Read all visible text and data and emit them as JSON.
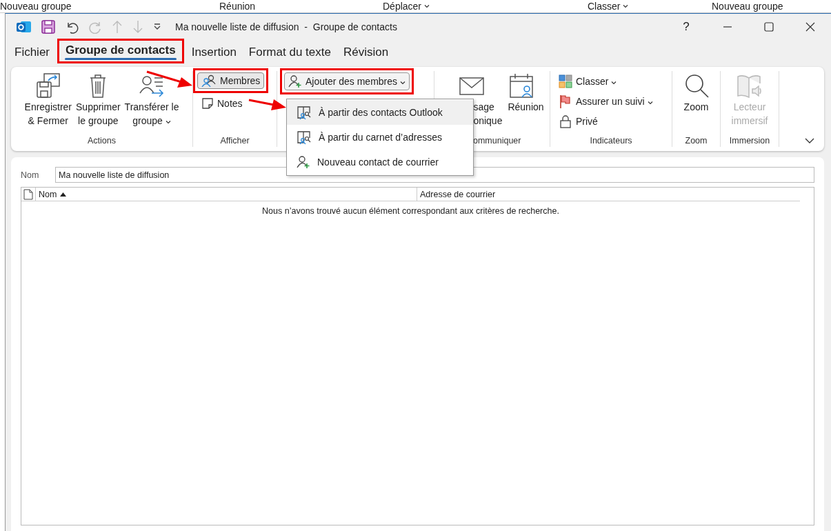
{
  "background_toolbar": [
    {
      "label": "Nouveau groupe",
      "dropdown": false
    },
    {
      "label": "Réunion",
      "dropdown": false
    },
    {
      "label": "Déplacer",
      "dropdown": true
    },
    {
      "label": "Classer",
      "dropdown": true
    },
    {
      "label": "Nouveau groupe",
      "dropdown": false
    }
  ],
  "window": {
    "title": "Ma nouvelle liste de diffusion  -  Groupe de contacts",
    "help": "?"
  },
  "tabs": [
    {
      "label": "Fichier",
      "selected": false,
      "highlighted": false
    },
    {
      "label": "Groupe de contacts",
      "selected": true,
      "highlighted": true
    },
    {
      "label": "Insertion",
      "selected": false,
      "highlighted": false
    },
    {
      "label": "Format du texte",
      "selected": false,
      "highlighted": false
    },
    {
      "label": "Révision",
      "selected": false,
      "highlighted": false
    }
  ],
  "ribbon": {
    "groups": [
      {
        "label": "Actions",
        "buttons": [
          {
            "kind": "large",
            "label": "Enregistrer\n& Fermer",
            "dropdown": false,
            "disabled": false
          },
          {
            "kind": "large",
            "label": "Supprimer\nle groupe",
            "dropdown": false,
            "disabled": false
          },
          {
            "kind": "large",
            "label": "Transférer le\ngroupe",
            "dropdown": true,
            "disabled": false
          }
        ]
      },
      {
        "label": "Afficher",
        "buttons": [
          {
            "kind": "small",
            "label": "Membres",
            "selected": true,
            "highlighted": true,
            "dropdown": false
          },
          {
            "kind": "small",
            "label": "Notes",
            "selected": false,
            "highlighted": false,
            "dropdown": false
          }
        ]
      },
      {
        "buttons": [
          {
            "kind": "small",
            "label": "Ajouter des membres",
            "highlighted": true,
            "dropdown": true,
            "expanded": true
          }
        ]
      },
      {
        "label": "ommuniquer",
        "buttons": [
          {
            "kind": "large",
            "label": "sage\nonique",
            "dropdown": false,
            "disabled": false
          },
          {
            "kind": "large",
            "label": "Réunion",
            "dropdown": false,
            "disabled": false
          }
        ]
      },
      {
        "label": "Indicateurs",
        "buttons": [
          {
            "kind": "small",
            "label": "Classer",
            "dropdown": true,
            "selected": false,
            "highlighted": false
          },
          {
            "kind": "small",
            "label": "Assurer un suivi",
            "dropdown": true,
            "selected": false,
            "highlighted": false
          },
          {
            "kind": "small",
            "label": "Privé",
            "dropdown": false,
            "selected": false,
            "highlighted": false
          }
        ]
      },
      {
        "label": "Zoom",
        "buttons": [
          {
            "kind": "large",
            "label": "Zoom",
            "dropdown": false,
            "disabled": false
          }
        ]
      },
      {
        "label": "Immersion",
        "buttons": [
          {
            "kind": "large",
            "label": "Lecteur\nimmersif",
            "dropdown": false,
            "disabled": true
          }
        ]
      }
    ]
  },
  "menu": {
    "items": [
      {
        "label": "À partir des contacts Outlook",
        "selected": true
      },
      {
        "label": "À partir du carnet d’adresses",
        "selected": false
      },
      {
        "label": "Nouveau contact de courrier",
        "selected": false
      }
    ]
  },
  "form": {
    "name_label": "Nom",
    "name_value": "Ma nouvelle liste de diffusion",
    "table": {
      "columns": [
        {
          "label": "Nom",
          "sorted_ascending": true
        },
        {
          "label": "Adresse de courrier",
          "sorted_ascending": false
        }
      ],
      "empty_message": "Nous n’avons trouvé aucun élément correspondant aux critères de recherche."
    }
  }
}
